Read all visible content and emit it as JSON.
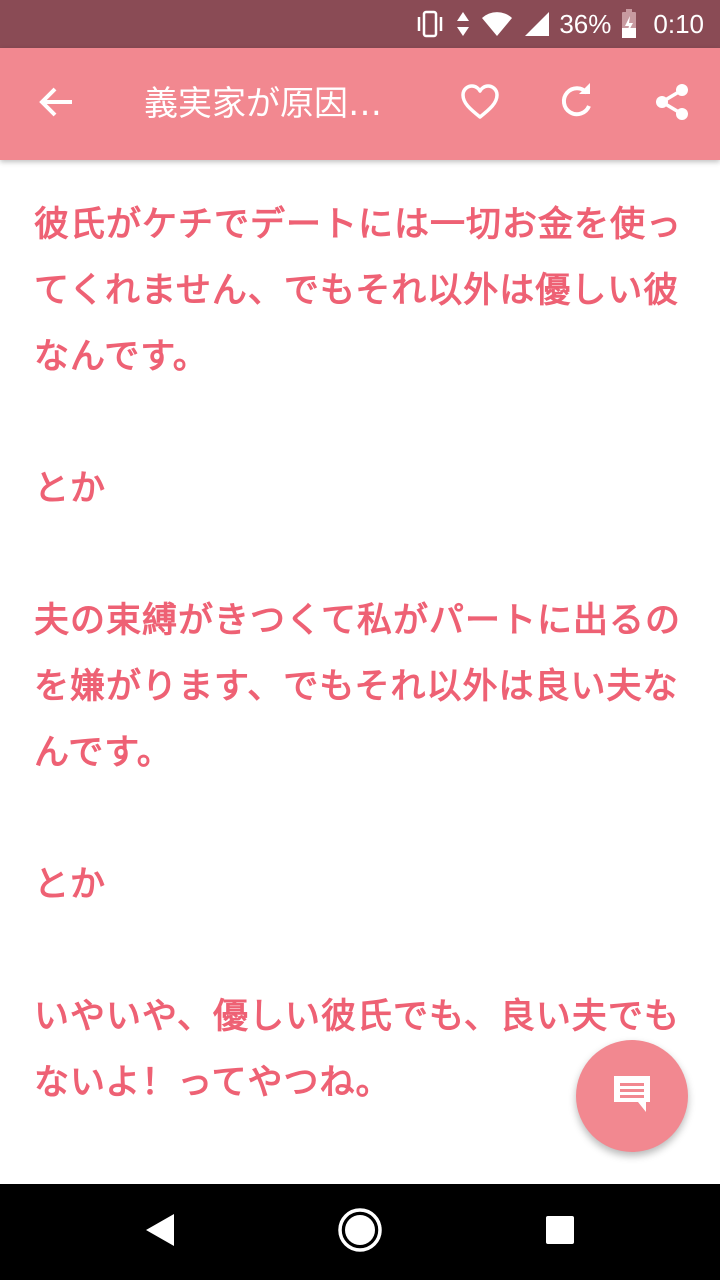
{
  "status_bar": {
    "battery_percent": "36%",
    "time": "0:10",
    "icons": [
      "vibrate-icon",
      "data-arrows-icon",
      "wifi-icon",
      "signal-icon",
      "battery-charging-icon"
    ]
  },
  "app_bar": {
    "title": "義実家が原因…",
    "icons": [
      "back-arrow-icon",
      "heart-icon",
      "refresh-icon",
      "share-icon"
    ]
  },
  "article": {
    "paragraphs": [
      "彼氏がケチでデートには一切お金を使ってくれません、でもそれ以外は優しい彼なんです。",
      "",
      "とか",
      "",
      "夫の束縛がきつくて私がパートに出るのを嫌がります、でもそれ以外は良い夫なんです。",
      "",
      "とか",
      "",
      "いやいや、優しい彼氏でも、良い夫でもないよ！ってやつね。"
    ]
  },
  "fab": {
    "icon": "comment-icon"
  },
  "nav_bar": {
    "icons": [
      "nav-back-icon",
      "nav-home-icon",
      "nav-recents-icon"
    ]
  },
  "colors": {
    "status_bar": "#8a4b55",
    "app_bar": "#f28890",
    "text_accent": "#ee6174",
    "nav_bar": "#000000"
  }
}
